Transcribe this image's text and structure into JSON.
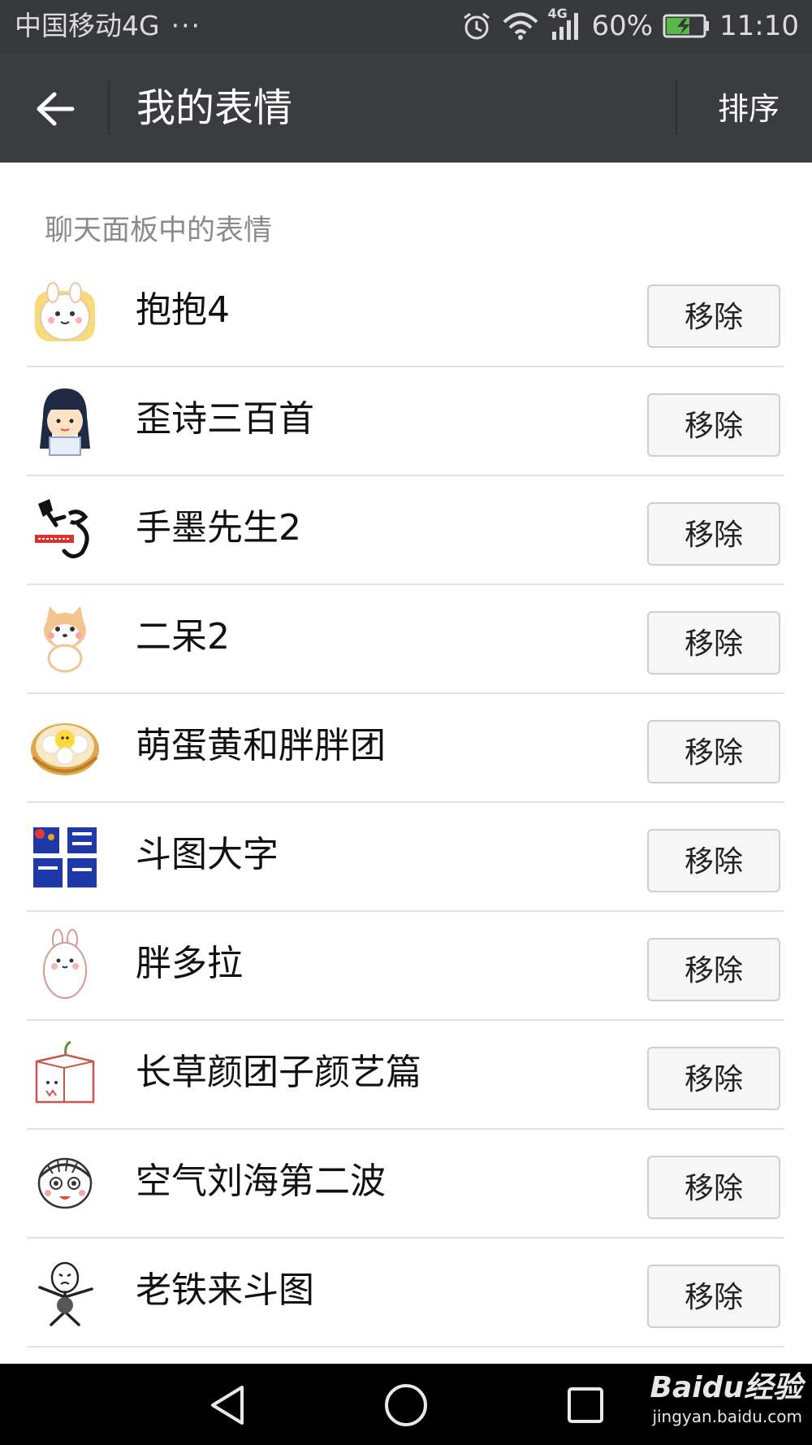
{
  "status_bar": {
    "carrier": "中国移动4G",
    "dots": "···",
    "network_badge": "4G",
    "battery": "60%",
    "time": "11:10"
  },
  "app_bar": {
    "title": "我的表情",
    "sort_label": "排序"
  },
  "section": {
    "header": "聊天面板中的表情"
  },
  "remove_label": "移除",
  "items": [
    {
      "name": "抱抱4",
      "icon": "hug-bunny-sticker-icon",
      "color": "#f3d66b"
    },
    {
      "name": "歪诗三百首",
      "icon": "scholar-boy-sticker-icon",
      "color": "#2c3e66"
    },
    {
      "name": "手墨先生2",
      "icon": "calligraphy-sticker-icon",
      "color": "#111111"
    },
    {
      "name": "二呆2",
      "icon": "shiba-dog-sticker-icon",
      "color": "#f4c58f"
    },
    {
      "name": "萌蛋黄和胖胖团",
      "icon": "steamer-buns-sticker-icon",
      "color": "#d9a24a"
    },
    {
      "name": "斗图大字",
      "icon": "big-text-sticker-icon",
      "color": "#1f3aa8"
    },
    {
      "name": "胖多拉",
      "icon": "chubby-rabbit-sticker-icon",
      "color": "#e9a3a0"
    },
    {
      "name": "长草颜团子颜艺篇",
      "icon": "box-bun-sticker-icon",
      "color": "#c7574d"
    },
    {
      "name": "空气刘海第二波",
      "icon": "bangs-girl-sticker-icon",
      "color": "#333333"
    },
    {
      "name": "老铁来斗图",
      "icon": "meme-man-sticker-icon",
      "color": "#222222"
    }
  ],
  "watermark": {
    "logo": "Baidu经验",
    "url": "jingyan.baidu.com"
  }
}
